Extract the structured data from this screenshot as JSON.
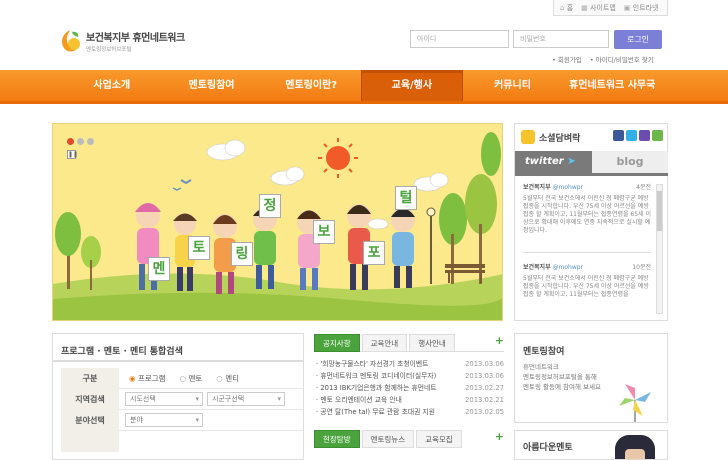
{
  "util": {
    "home": "홈",
    "sitemap": "사이트맵",
    "intranet": "인트라넷"
  },
  "logo": {
    "title": "보건복지부 휴먼네트워크",
    "subtitle": "멘토링정보허브포털"
  },
  "login": {
    "id_placeholder": "아이디",
    "pw_placeholder": "비밀번호",
    "button": "로그인",
    "join": "회원가입",
    "find": "아이디/비밀번호 찾기"
  },
  "nav": {
    "items": [
      "사업소개",
      "멘토링참여",
      "멘토링이란?",
      "교육/행사",
      "커뮤니티",
      "휴먼네트워크 사무국"
    ]
  },
  "banner": {
    "signs": [
      "멘",
      "토",
      "링",
      "정",
      "보",
      "포",
      "털"
    ]
  },
  "social": {
    "title": "소셜담벼락",
    "tab_twitter": "twitter",
    "tab_blog": "blog",
    "tweets": [
      {
        "author": "보건복지부",
        "handle": "@mohwpr",
        "time": "4분전",
        "text": "5월부터 전국 보건소에서 어린신 청 폐렴구균 예방접종을 시작합니다. 우선 75세 이상 어르신을 예방접종 할 계획이고, 11월부터는 접종연령을 65세 이상으로 확대해 이후에도 연중 지속적으로 실시할 예정입니다."
      },
      {
        "author": "보건복지부",
        "handle": "@mohwpr",
        "time": "10분전",
        "text": "5월부터 전국 보건소에서 어린신 청 폐렴구균 예방접종을 시작합니다. 우선 75세 이상 어르신을 예방접종 할 계획이고, 11월부터는 접종연령을"
      }
    ]
  },
  "search": {
    "title": "프로그램 · 멘토 · 멘티 통합검색",
    "rows": [
      {
        "label": "구분",
        "options": [
          "프로그램",
          "멘토",
          "멘티"
        ]
      },
      {
        "label": "지역검색",
        "sel1": "시도선택",
        "sel2": "시군구선택"
      },
      {
        "label": "분야선택",
        "sel1": "분야"
      }
    ]
  },
  "notice": {
    "tabs": [
      "공지사항",
      "교육안내",
      "행사안내"
    ],
    "items": [
      {
        "title": "'희망농구물스타' 자선경기 초청이벤트",
        "date": "2013.03.06"
      },
      {
        "title": "휴먼네트워크 멘토링 코디네이터(실무자)",
        "date": "2013.03.06"
      },
      {
        "title": "2013 IBK기업은행과 함께하는 휴먼네트",
        "date": "2013.02.27"
      },
      {
        "title": "멘토 오리엔테이션 교육 안내",
        "date": "2013.02.21"
      },
      {
        "title": "공연 탈(The tal) 무료 관람 초대권 지원",
        "date": "2013.02.05"
      }
    ],
    "tabs2": [
      "현장탐방",
      "멘토링뉴스",
      "교육모집"
    ]
  },
  "mentoring": {
    "title": "멘토링참여",
    "desc": [
      "휴먼네트워크",
      "멘토링정보허브포털을 통해",
      "멘토링 활동에 참여해 보세요"
    ]
  },
  "mentor": {
    "title": "아름다운멘토"
  },
  "colors": {
    "nav": "#f37b12",
    "active": "#d96008",
    "green": "#4aa33d",
    "login": "#7c7fd6"
  }
}
